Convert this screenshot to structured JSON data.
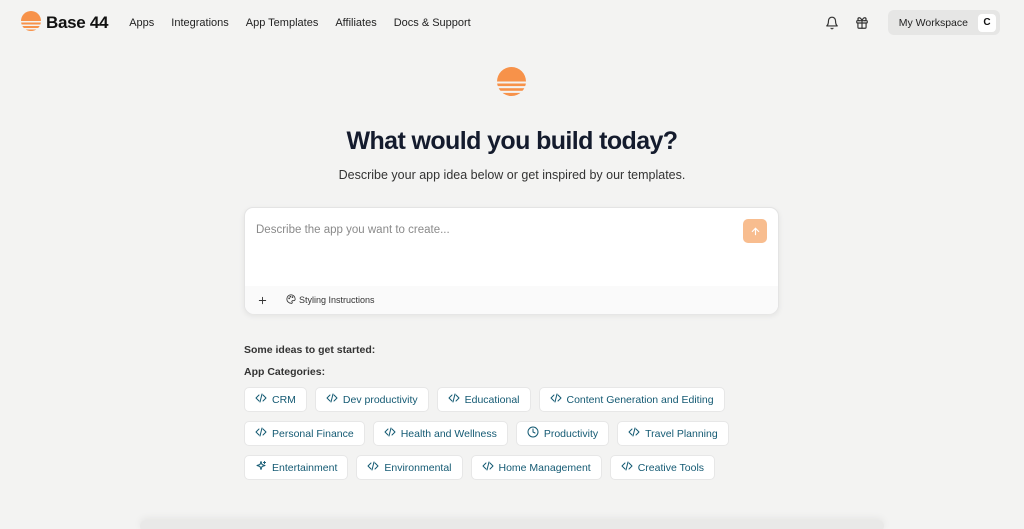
{
  "brand": {
    "name": "Base 44",
    "color": "#f7924a"
  },
  "nav": [
    {
      "label": "Apps"
    },
    {
      "label": "Integrations"
    },
    {
      "label": "App Templates"
    },
    {
      "label": "Affiliates"
    },
    {
      "label": "Docs & Support"
    }
  ],
  "header": {
    "workspace_label": "My Workspace",
    "avatar_initial": "C",
    "icons": [
      "bell-icon",
      "gift-icon"
    ]
  },
  "hero": {
    "headline": "What would you build today?",
    "subheadline": "Describe your app idea below or get inspired by our templates."
  },
  "prompt": {
    "placeholder": "Describe the app you want to create...",
    "value": "",
    "styling_label": "Styling Instructions",
    "send_color": "#f8bd8f"
  },
  "ideas": {
    "title": "Some ideas to get started:",
    "categories_title": "App Categories:",
    "rows": [
      [
        {
          "label": "CRM",
          "icon": "code-icon"
        },
        {
          "label": "Dev productivity",
          "icon": "code-icon"
        },
        {
          "label": "Educational",
          "icon": "code-icon"
        },
        {
          "label": "Content Generation and Editing",
          "icon": "code-icon"
        }
      ],
      [
        {
          "label": "Personal Finance",
          "icon": "code-icon"
        },
        {
          "label": "Health and Wellness",
          "icon": "code-icon"
        },
        {
          "label": "Productivity",
          "icon": "clock-icon"
        },
        {
          "label": "Travel Planning",
          "icon": "code-icon"
        }
      ],
      [
        {
          "label": "Entertainment",
          "icon": "sparkle-icon"
        },
        {
          "label": "Environmental",
          "icon": "code-icon"
        },
        {
          "label": "Home Management",
          "icon": "code-icon"
        },
        {
          "label": "Creative Tools",
          "icon": "code-icon"
        }
      ]
    ],
    "accent_color": "#145a73"
  }
}
